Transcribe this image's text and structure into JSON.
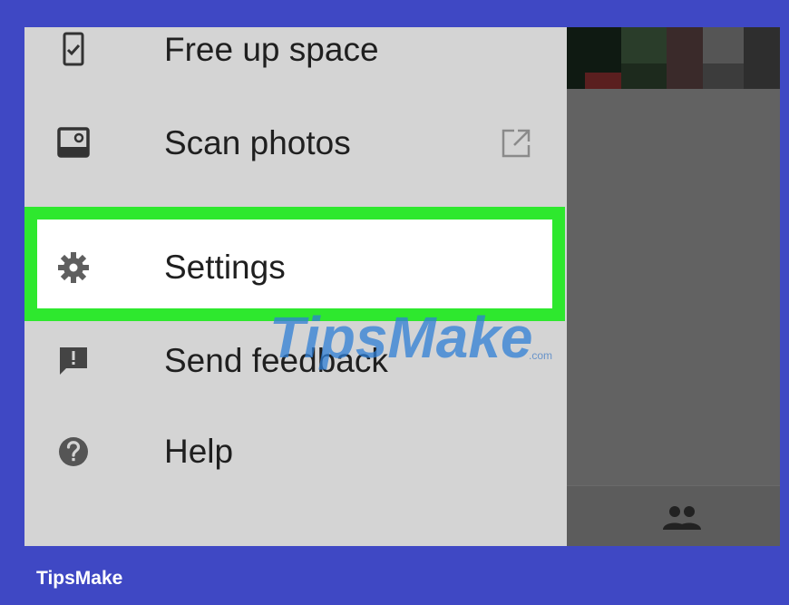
{
  "drawer": {
    "items": [
      {
        "label": "Free up space",
        "icon": "phone-check-icon"
      },
      {
        "label": "Scan photos",
        "icon": "photo-scan-icon",
        "trailing_icon": "open-external-icon"
      },
      {
        "label": "Settings",
        "icon": "gear-icon",
        "highlighted": true
      },
      {
        "label": "Send feedback",
        "icon": "feedback-icon"
      },
      {
        "label": "Help",
        "icon": "help-icon"
      }
    ]
  },
  "bottom_nav": {
    "icon": "people-icon"
  },
  "watermark": {
    "text": "TipsMake",
    "suffix": ".com"
  },
  "footer": {
    "brand": "TipsMake"
  },
  "colors": {
    "frame": "#3f48c4",
    "highlight": "#2ee82e",
    "drawer": "#d4d4d4"
  }
}
